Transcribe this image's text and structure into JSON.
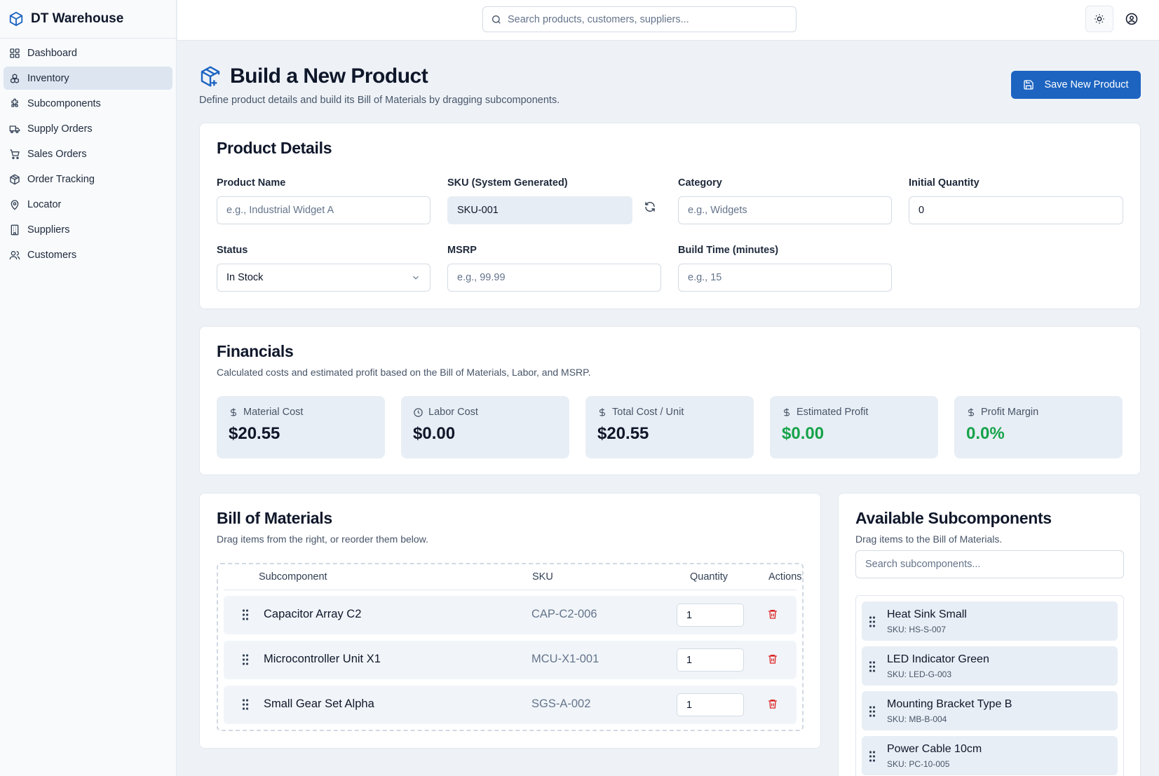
{
  "app": {
    "name": "DT Warehouse"
  },
  "sidebar": {
    "items": [
      {
        "label": "Dashboard",
        "icon": "dashboard-icon"
      },
      {
        "label": "Inventory",
        "icon": "boxes-icon",
        "active": true
      },
      {
        "label": "Subcomponents",
        "icon": "puzzle-icon"
      },
      {
        "label": "Supply Orders",
        "icon": "truck-icon"
      },
      {
        "label": "Sales Orders",
        "icon": "cart-icon"
      },
      {
        "label": "Order Tracking",
        "icon": "package-icon"
      },
      {
        "label": "Locator",
        "icon": "map-pin-icon"
      },
      {
        "label": "Suppliers",
        "icon": "building-icon"
      },
      {
        "label": "Customers",
        "icon": "users-icon"
      }
    ]
  },
  "topbar": {
    "search_placeholder": "Search products, customers, suppliers..."
  },
  "header": {
    "title": "Build a New Product",
    "subtitle": "Define product details and build its Bill of Materials by dragging subcomponents.",
    "save_label": "Save New Product"
  },
  "details": {
    "title": "Product Details",
    "product_name": {
      "label": "Product Name",
      "placeholder": "e.g., Industrial Widget A"
    },
    "sku": {
      "label": "SKU (System Generated)",
      "value": "SKU-001"
    },
    "category": {
      "label": "Category",
      "placeholder": "e.g., Widgets"
    },
    "initial_quantity": {
      "label": "Initial Quantity",
      "value": "0"
    },
    "status": {
      "label": "Status",
      "value": "In Stock"
    },
    "msrp": {
      "label": "MSRP",
      "placeholder": "e.g., 99.99"
    },
    "build_time": {
      "label": "Build Time (minutes)",
      "placeholder": "e.g., 15"
    }
  },
  "financials": {
    "title": "Financials",
    "subtitle": "Calculated costs and estimated profit based on the Bill of Materials, Labor, and MSRP.",
    "stats": [
      {
        "label": "Material Cost",
        "value": "$20.55",
        "icon": "dollar-icon"
      },
      {
        "label": "Labor Cost",
        "value": "$0.00",
        "icon": "clock-icon"
      },
      {
        "label": "Total Cost / Unit",
        "value": "$20.55",
        "icon": "dollar-icon"
      },
      {
        "label": "Estimated Profit",
        "value": "$0.00",
        "icon": "dollar-icon",
        "accent": "#16a34a"
      },
      {
        "label": "Profit Margin",
        "value": "0.0%",
        "icon": "dollar-icon",
        "accent": "#16a34a"
      }
    ]
  },
  "bom": {
    "title": "Bill of Materials",
    "subtitle": "Drag items from the right, or reorder them below.",
    "columns": {
      "subcomponent": "Subcomponent",
      "sku": "SKU",
      "quantity": "Quantity",
      "actions": "Actions"
    },
    "rows": [
      {
        "name": "Capacitor Array C2",
        "sku": "CAP-C2-006",
        "qty": "1"
      },
      {
        "name": "Microcontroller Unit X1",
        "sku": "MCU-X1-001",
        "qty": "1"
      },
      {
        "name": "Small Gear Set Alpha",
        "sku": "SGS-A-002",
        "qty": "1"
      }
    ]
  },
  "available": {
    "title": "Available Subcomponents",
    "subtitle": "Drag items to the Bill of Materials.",
    "search_placeholder": "Search subcomponents...",
    "items": [
      {
        "name": "Heat Sink Small",
        "sku": "SKU: HS-S-007"
      },
      {
        "name": "LED Indicator Green",
        "sku": "SKU: LED-G-003"
      },
      {
        "name": "Mounting Bracket Type B",
        "sku": "SKU: MB-B-004"
      },
      {
        "name": "Power Cable 10cm",
        "sku": "SKU: PC-10-005"
      }
    ]
  },
  "colors": {
    "accent": "#1d64c1",
    "positive": "#16a34a",
    "danger": "#dc2626"
  }
}
